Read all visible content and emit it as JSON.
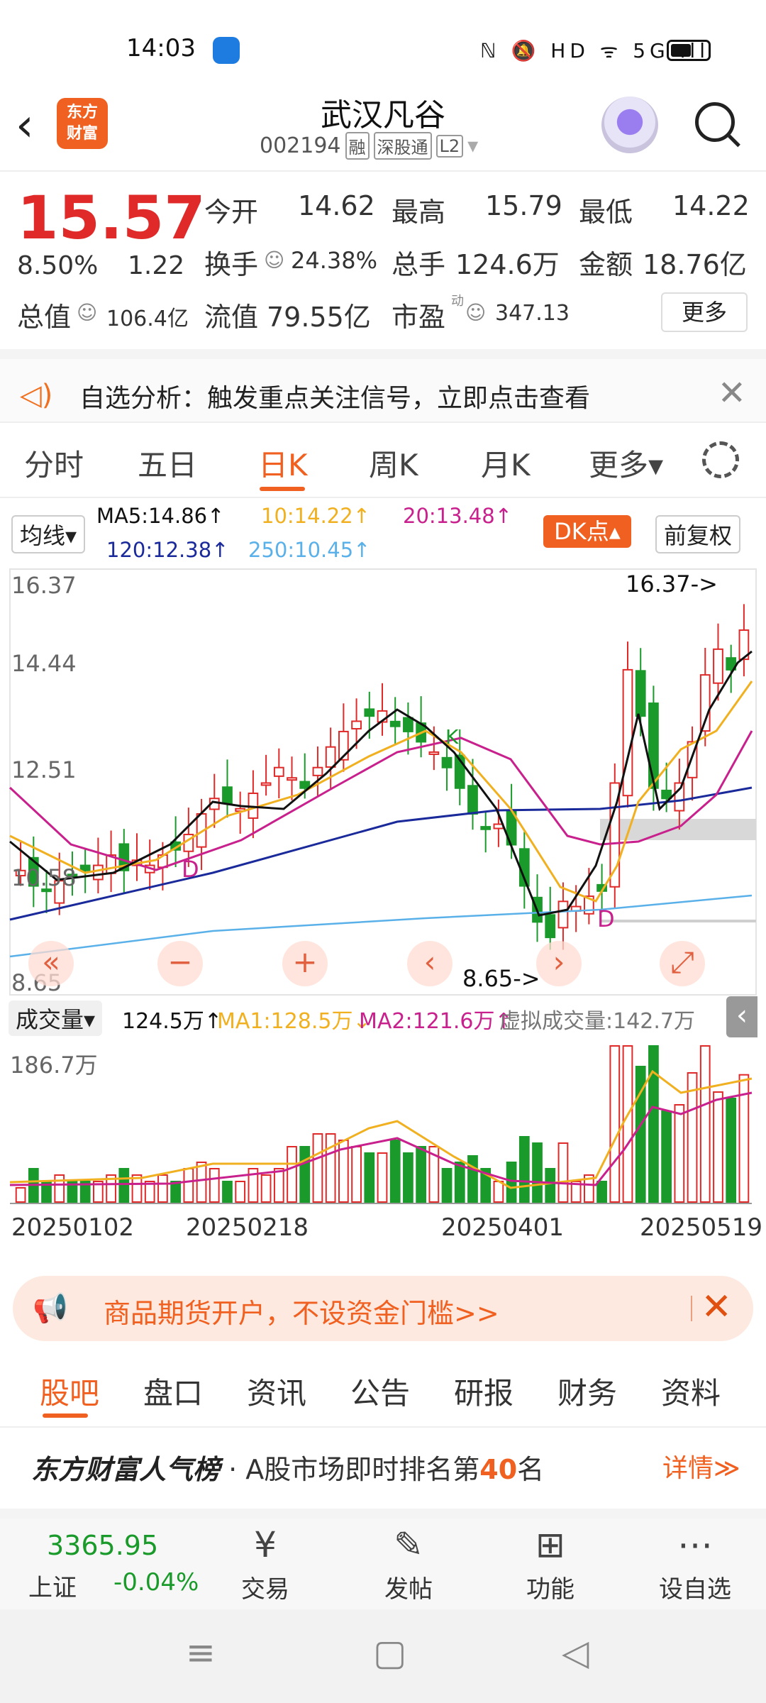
{
  "status": {
    "time": "14:03",
    "icons": "ℕ 🔕 HD ᯤ 5G ıll"
  },
  "header": {
    "back_icon": "‹",
    "logo_line1": "东方",
    "logo_line2": "财富",
    "name": "武汉凡谷",
    "code": "002194",
    "tag_margin": "融",
    "tag_connect": "深股通",
    "tag_l2": "L2",
    "dropdown": "▾"
  },
  "quote": {
    "price": "15.57",
    "pct": "8.50%",
    "chg": "1.22",
    "open_label": "今开",
    "open": "14.62",
    "high_label": "最高",
    "high": "15.79",
    "low_label": "最低",
    "low": "14.22",
    "turnover_label": "换手",
    "turnover": "24.38%",
    "volume_label": "总手",
    "volume": "124.6万",
    "amount_label": "金额",
    "amount": "18.76亿",
    "mktcap_label": "总值",
    "mktcap": "106.4亿",
    "float_label": "流值",
    "float": "79.55亿",
    "pe_label": "市盈",
    "pe_sup": "动",
    "pe": "347.13",
    "more": "更多"
  },
  "notice": {
    "text": "自选分析：触发重点关注信号，立即点击查看",
    "close": "✕"
  },
  "period_tabs": [
    "分时",
    "五日",
    "日K",
    "周K",
    "月K",
    "更多▾"
  ],
  "ma": {
    "selector": "均线▾",
    "ma5": "MA5:14.86↑",
    "ma10": "10:14.22↑",
    "ma20": "20:13.48↑",
    "ma120": "120:12.38↑",
    "ma250": "250:10.45↑",
    "dk": "DK点▴",
    "fq": "前复权"
  },
  "price_axis": [
    "16.37",
    "14.44",
    "12.51",
    "10.58",
    "8.65"
  ],
  "annotations": {
    "high": "16.37->",
    "low": "8.65->",
    "k": "K",
    "d1": "D",
    "d2": "D"
  },
  "chart_controls": [
    "«",
    "−",
    "+",
    "‹",
    "›",
    "⤢"
  ],
  "volume": {
    "selector": "成交量▾",
    "vol": "124.5万↑",
    "ma1": "MA1:128.5万↓",
    "ma2": "MA2:121.6万↑",
    "virtual": "虚拟成交量:142.7万",
    "max": "186.7万",
    "side": "‹"
  },
  "dates": [
    "20250102",
    "20250218",
    "20250401",
    "20250519"
  ],
  "colors": {
    "up": "#e02a2a",
    "down": "#1a9a2a",
    "accent": "#f06020",
    "ma5": "#111111",
    "ma10": "#f0b020",
    "ma20": "#c8208c",
    "ma120": "#1a2a9a",
    "ma250": "#5ab0e8"
  },
  "ad": {
    "text": "商品期货开户，不设资金门槛>>",
    "icon": "megaphone-icon",
    "close": "✕"
  },
  "bottom_tabs": [
    "股吧",
    "盘口",
    "资讯",
    "公告",
    "研报",
    "财务",
    "资料"
  ],
  "popularity": {
    "brand": "东方财富人气榜",
    "text": "· A股市场即时排名第",
    "rank": "40",
    "suffix": "名",
    "detail": "详情≫"
  },
  "toolbar": {
    "index_value": "3365.95",
    "index_name": "上证",
    "index_change": "-0.04%",
    "buttons": [
      {
        "icon": "¥",
        "label": "交易"
      },
      {
        "icon": "✎",
        "label": "发帖"
      },
      {
        "icon": "⊞",
        "label": "功能"
      },
      {
        "icon": "⋯",
        "label": "设自选"
      }
    ]
  },
  "nav": [
    "≡",
    "▢",
    "◁"
  ],
  "chart_data": {
    "type": "candlestick",
    "price_range": [
      8.65,
      16.37
    ],
    "volume_max": "186.7万",
    "closes": [
      10.9,
      10.6,
      10.5,
      10.7,
      10.8,
      10.9,
      11.0,
      11.2,
      10.9,
      11.1,
      11.0,
      11.2,
      11.3,
      11.6,
      12.0,
      12.3,
      12.2,
      12.1,
      12.4,
      12.6,
      12.9,
      12.7,
      12.5,
      12.9,
      13.3,
      13.6,
      13.8,
      13.9,
      14.0,
      13.7,
      13.6,
      13.4,
      13.2,
      12.9,
      12.5,
      12.0,
      11.7,
      11.8,
      11.4,
      10.6,
      9.9,
      9.6,
      10.3,
      10.2,
      10.4,
      10.5,
      12.6,
      14.8,
      13.9,
      12.5,
      12.3,
      12.6,
      13.4,
      14.7,
      15.2,
      14.8,
      15.57
    ],
    "ma5": "14.86",
    "ma10": "14.22",
    "ma20": "13.48",
    "ma120": "12.38",
    "ma250": "10.45"
  }
}
